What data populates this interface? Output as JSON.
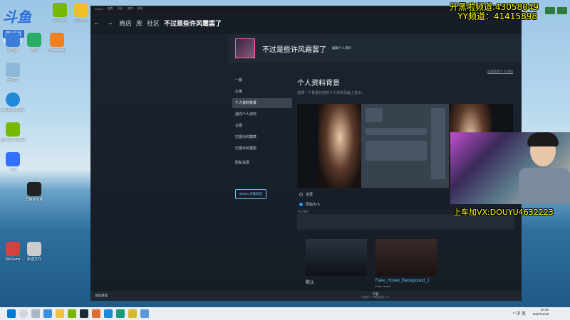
{
  "desktop": {
    "logo": {
      "big": "斗鱼",
      "small": "房间号",
      "num": "4632223"
    },
    "icons": [
      {
        "label": "此电脑",
        "color": "#3b7dd8"
      },
      {
        "label": "微信",
        "color": "#2aae67"
      },
      {
        "label": "GeForce",
        "color": "#76b900"
      },
      {
        "label": "QQ音乐",
        "color": "#f0c020"
      },
      {
        "label": "回收站",
        "color": "#8fb8d8"
      },
      {
        "label": "Overwatch",
        "color": "#f08020"
      },
      {
        "label": "Microsoft Edge",
        "color": "#1f8ad8"
      },
      {
        "label": "GeForce Experience",
        "color": "#76b900"
      },
      {
        "label": "飞书",
        "color": "#3370ff"
      },
      {
        "label": "剪映专业版",
        "color": "#222222"
      },
      {
        "label": "WeGame",
        "color": "#d84040"
      },
      {
        "label": "新建文件",
        "color": "#cccccc"
      }
    ]
  },
  "steam": {
    "topbar": [
      "Steam",
      "查看",
      "好友",
      "游戏",
      "帮助"
    ],
    "nav": {
      "back": "←",
      "forward": "→",
      "store": "商店",
      "library": "库",
      "community": "社区",
      "title": "不过是些许风霜罢了"
    },
    "profile": {
      "name": "不过是些许风霜罢了",
      "edit": "编辑个人资料"
    },
    "sidenav": [
      {
        "label": "一般",
        "active": false
      },
      {
        "label": "头像",
        "active": false
      },
      {
        "label": "个人资料背景",
        "active": true
      },
      {
        "label": "迷你个人资料",
        "active": false
      },
      {
        "label": "主题",
        "active": false
      },
      {
        "label": "已展示的徽章",
        "active": false
      },
      {
        "label": "已展示的展柜",
        "active": false
      },
      {
        "label": "隐私设置",
        "active": false
      }
    ],
    "points_shop": "Steam 点数商店",
    "main": {
      "back_link": "返回您的个人资料",
      "title": "个人资料背景",
      "subtitle": "选择一个背景在您的个人资料页面上显示。"
    },
    "options": {
      "full": "全屏",
      "original": "原始大小",
      "selected": "original"
    },
    "filter_label": "FILTER",
    "backgrounds": [
      {
        "label": "默认",
        "sub": ""
      },
      {
        "label": "Fake_Hostel_Background_1",
        "sub": "Fake Hostel"
      }
    ],
    "bottombar": {
      "add_game": "添加游戏",
      "download": "下载",
      "download_sub": "已完成 4 个项目中的 4 个"
    }
  },
  "overlay": {
    "line1": "开黑啦频道:43058049",
    "line2": "YY频道：41415898",
    "line3": "上车加VX:DOUYU4632223"
  },
  "taskbar": {
    "time": "20:36",
    "date": "2022/11/19",
    "tray": "^ 中 英"
  }
}
